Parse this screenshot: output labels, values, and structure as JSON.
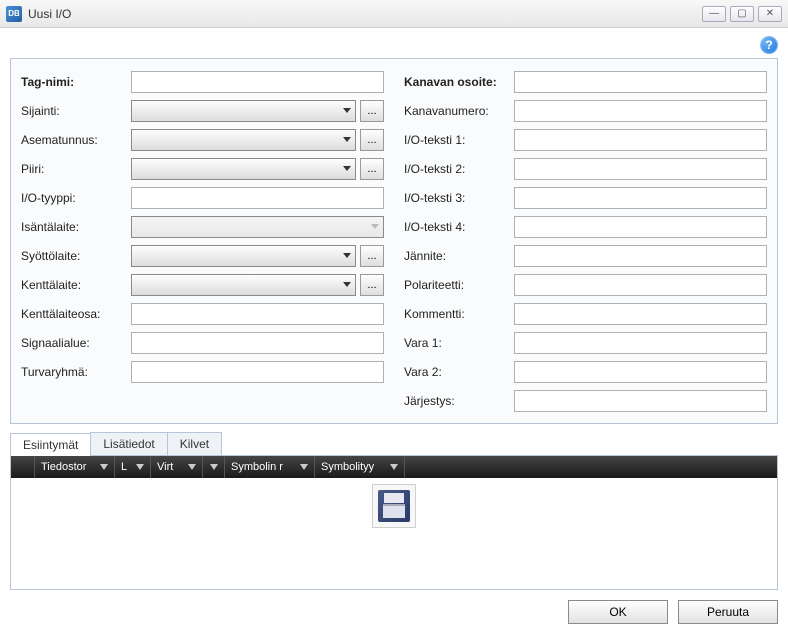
{
  "window": {
    "title": "Uusi I/O",
    "icon_text": "DB"
  },
  "left_fields": {
    "tag": {
      "label": "Tag-nimi:",
      "value": ""
    },
    "sijainti": {
      "label": "Sijainti:",
      "value": ""
    },
    "asematunnus": {
      "label": "Asematunnus:",
      "value": ""
    },
    "piiri": {
      "label": "Piiri:",
      "value": ""
    },
    "iotyyppi": {
      "label": "I/O-tyyppi:",
      "value": ""
    },
    "isantalaite": {
      "label": "Isäntälaite:",
      "value": ""
    },
    "syottolaite": {
      "label": "Syöttölaite:",
      "value": ""
    },
    "kenttalaite": {
      "label": "Kenttälaite:",
      "value": ""
    },
    "kenttalaiteosa": {
      "label": "Kenttälaiteosa:",
      "value": ""
    },
    "signaalialue": {
      "label": "Signaalialue:",
      "value": ""
    },
    "turvaryhma": {
      "label": "Turvaryhmä:",
      "value": ""
    }
  },
  "right_fields": {
    "kanavan_osoite": {
      "label": "Kanavan osoite:",
      "value": ""
    },
    "kanavanumero": {
      "label": "Kanavanumero:",
      "value": ""
    },
    "ioteksti1": {
      "label": "I/O-teksti 1:",
      "value": ""
    },
    "ioteksti2": {
      "label": "I/O-teksti 2:",
      "value": ""
    },
    "ioteksti3": {
      "label": "I/O-teksti 3:",
      "value": ""
    },
    "ioteksti4": {
      "label": "I/O-teksti 4:",
      "value": ""
    },
    "jannite": {
      "label": "Jännite:",
      "value": ""
    },
    "polariteetti": {
      "label": "Polariteetti:",
      "value": ""
    },
    "kommentti": {
      "label": "Kommentti:",
      "value": ""
    },
    "vara1": {
      "label": "Vara 1:",
      "value": ""
    },
    "vara2": {
      "label": "Vara 2:",
      "value": ""
    },
    "jarjestys": {
      "label": "Järjestys:",
      "value": ""
    }
  },
  "tabs": {
    "esiintymat": "Esiintymät",
    "lisatiedot": "Lisätiedot",
    "kilvet": "Kilvet"
  },
  "grid_columns": {
    "tiedostor": "Tiedostor",
    "l": "L",
    "virt": "Virt",
    "symbolin_r": "Symbolin r",
    "symbolityy": "Symbolityy"
  },
  "buttons": {
    "ok": "OK",
    "cancel": "Peruuta",
    "ellipsis": "..."
  }
}
